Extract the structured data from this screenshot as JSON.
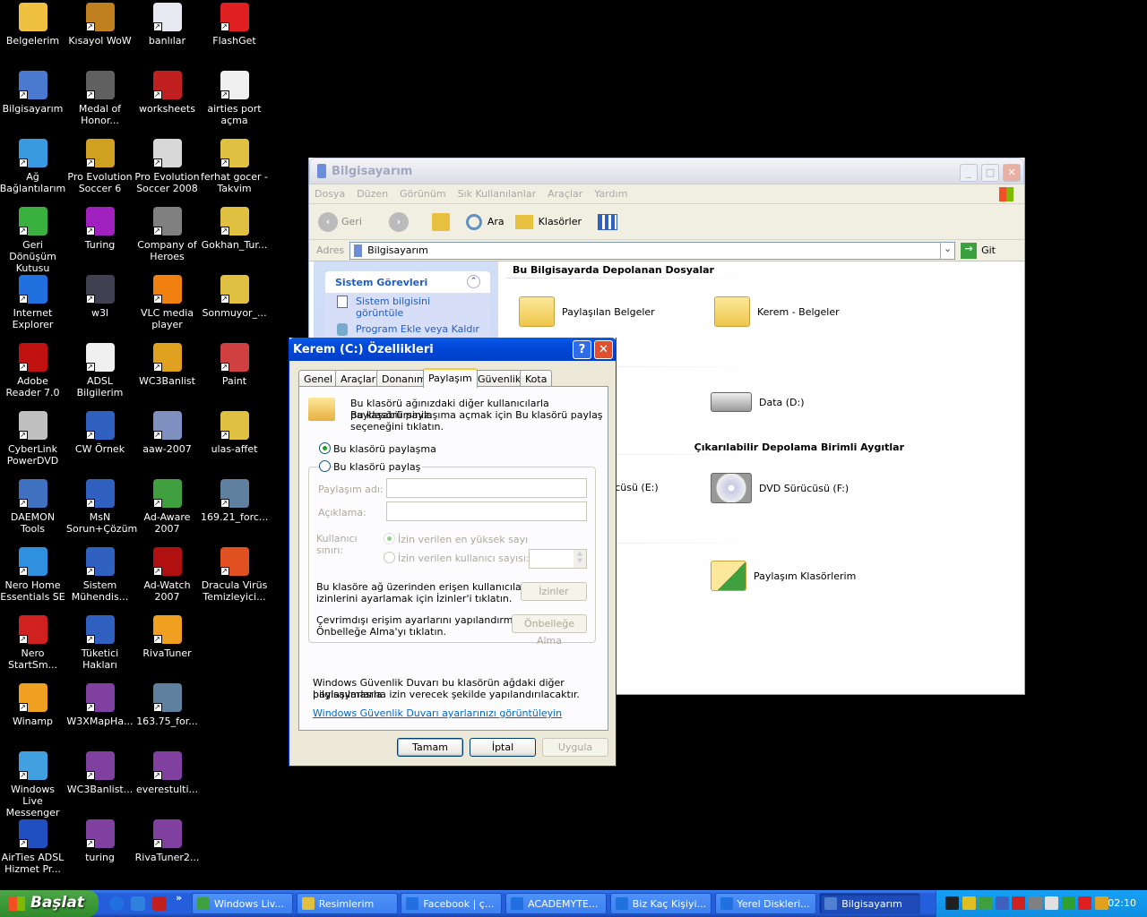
{
  "desktop": {
    "icons": [
      [
        "Belgelerim",
        "Kısayol WoW",
        "banlılar",
        "FlashGet"
      ],
      [
        "Bilgisayarım",
        "Medal of Honor...",
        "worksheets",
        "airties port açma"
      ],
      [
        "Ağ Bağlantılarım",
        "Pro Evolution Soccer 6",
        "Pro Evolution Soccer 2008",
        "ferhat gocer - Takvim"
      ],
      [
        "Geri Dönüşüm Kutusu",
        "Turing",
        "Company of Heroes",
        "Gokhan_Tur..."
      ],
      [
        "Internet Explorer",
        "w3l",
        "VLC media player",
        "Sonmuyor_..."
      ],
      [
        "Adobe Reader 7.0",
        "ADSL Bilgilerim",
        "WC3Banlist",
        "Paint"
      ],
      [
        "CyberLink PowerDVD",
        "CW Örnek",
        "aaw-2007",
        "ulas-affet"
      ],
      [
        "DAEMON Tools",
        "MsN Sorun+Çözüm",
        "Ad-Aware 2007",
        "169.21_forc..."
      ],
      [
        "Nero Home Essentials SE",
        "Sistem Mühendis...",
        "Ad-Watch 2007",
        "Dracula Virüs Temizleyici..."
      ],
      [
        "Nero StartSm...",
        "Tüketici Hakları",
        "RivaTuner",
        ""
      ],
      [
        "Winamp",
        "W3XMapHa...",
        "163.75_for...",
        ""
      ],
      [
        "Windows Live Messenger",
        "WC3Banlist...",
        "everestulti...",
        ""
      ],
      [
        "AirTies ADSL Hizmet Pr...",
        "turing",
        "RivaTuner2...",
        ""
      ]
    ],
    "icon_colors": [
      [
        "#f0c040",
        "#c08020",
        "#e8e8f0",
        "#e02020"
      ],
      [
        "#4a7ad0",
        "#606060",
        "#c02020",
        "#f0f0f0"
      ],
      [
        "#3a9ae0",
        "#d0a020",
        "#d8d8d8",
        "#e0c040"
      ],
      [
        "#3ab040",
        "#a020c0",
        "#808080",
        "#e0c040"
      ],
      [
        "#2070e0",
        "#404050",
        "#f08010",
        "#e0c040"
      ],
      [
        "#c01010",
        "#f0f0f0",
        "#e0a020",
        "#d04040"
      ],
      [
        "#c0c0c0",
        "#3060c0",
        "#8090c0",
        "#e0c040"
      ],
      [
        "#4070c0",
        "#3060c0",
        "#40a040",
        "#6080a0"
      ],
      [
        "#3090e0",
        "#3060c0",
        "#b01010",
        "#e05020"
      ],
      [
        "#d02020",
        "#3060c0",
        "#f0a020",
        ""
      ],
      [
        "#f0a020",
        "#8040a0",
        "#6080a0",
        ""
      ],
      [
        "#40a0e0",
        "#8040a0",
        "#8040a0",
        ""
      ],
      [
        "#2050c0",
        "#8040a0",
        "#8040a0",
        ""
      ]
    ]
  },
  "explorer": {
    "title": "Bilgisayarım",
    "menu": [
      "Dosya",
      "Düzen",
      "Görünüm",
      "Sık Kullanılanlar",
      "Araçlar",
      "Yardım"
    ],
    "toolbar": {
      "back": "Geri",
      "search": "Ara",
      "folders": "Klasörler"
    },
    "address_label": "Adres",
    "address_value": "Bilgisayarım",
    "go_label": "Git",
    "tasks_title": "Sistem Görevleri",
    "tasks": [
      "Sistem bilgisini görüntüle",
      "Program Ekle veya Kaldır"
    ],
    "sections": {
      "files": "Bu Bilgisayarda Depolanan Dosyalar",
      "removable": "Çıkarılabilir Depolama Birimli Aygıtlar"
    },
    "items": {
      "shared_docs": "Paylaşılan Belgeler",
      "kerem_docs": "Kerem - Belgeler",
      "data_d": "Data (D:)",
      "drive_e": "DVD Sürücüsü (E:)",
      "dvd_f": "DVD Sürücüsü (F:)",
      "shared_folders": "Paylaşım Klasörlerim"
    }
  },
  "dialog": {
    "title": "Kerem (C:) Özellikleri",
    "tabs": [
      "Genel",
      "Araçlar",
      "Donanım",
      "Paylaşım",
      "Güvenlik",
      "Kota"
    ],
    "active_tab": "Paylaşım",
    "intro": [
      "Bu klasörü ağınızdaki diğer kullanıcılarla paylaşabilirsiniz.",
      "Bu klasörü paylaşıma açmak için Bu klasörü paylaş",
      "seçeneğini tıklatın."
    ],
    "radio_no_share": "Bu klasörü paylaşma",
    "radio_share": "Bu klasörü paylaş",
    "share_name_label": "Paylaşım adı:",
    "share_name_value": "",
    "comment_label": "Açıklama:",
    "comment_value": "",
    "user_limit_label": [
      "Kullanıcı",
      "sınırı:"
    ],
    "limit_max": "İzin verilen en yüksek sayı",
    "limit_count": "İzin verilen kullanıcı sayısı:",
    "permissions_text": [
      "Bu klasöre ağ üzerinden erişen kullanıcıların",
      "izinlerini ayarlamak için İzinler'i tıklatın."
    ],
    "permissions_button": "İzinler",
    "caching_text": [
      "Çevrimdışı erişim ayarlarını yapılandırmak için",
      "Önbelleğe Alma'yı tıklatın."
    ],
    "caching_button": "Önbelleğe Alma",
    "firewall_text": [
      "Windows Güvenlik Duvarı bu klasörün ağdaki diğer bilgisayarlarla",
      "paylaşılmasına izin verecek şekilde yapılandırılacaktır."
    ],
    "firewall_link": "Windows Güvenlik Duvarı ayarlarınızı görüntüleyin",
    "ok": "Tamam",
    "cancel": "İptal",
    "apply": "Uygula",
    "selected_option": "Bu klasörü paylaşma"
  },
  "taskbar": {
    "start": "Başlat",
    "more": "»",
    "tasks": [
      "Windows Liv...",
      "Resimlerim",
      "Facebook | ç...",
      "ACADEMYTE...",
      "Biz Kaç Kişiyi...",
      "Yerel Diskleri...",
      "Bilgisayarım"
    ],
    "task_colors": [
      "#40a040",
      "#e0c040",
      "#2070e0",
      "#2070e0",
      "#2070e0",
      "#2070e0",
      "#5080d0"
    ],
    "active_task": "Bilgisayarım",
    "tray_colors": [
      "#202020",
      "#e0c020",
      "#40a040",
      "#4060c0",
      "#d02020",
      "#808080",
      "#e0e0e0",
      "#30a030",
      "#e02020",
      "#e0a020"
    ],
    "clock": "02:10"
  }
}
